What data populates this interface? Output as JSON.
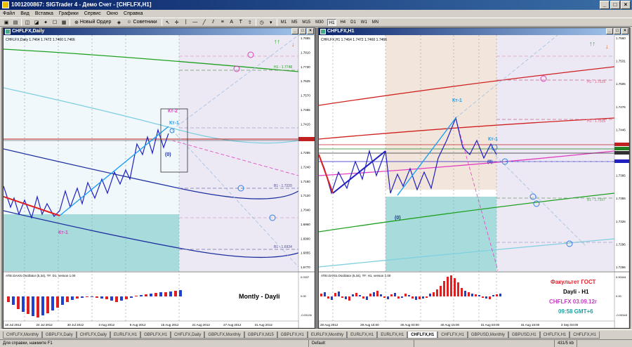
{
  "window": {
    "title": "1001200867: SIGTrader 4 - Демо Счет - [CHFLFX,H1]"
  },
  "menu": [
    "Файл",
    "Вид",
    "Вставка",
    "Графики",
    "Сервис",
    "Окно",
    "Справка"
  ],
  "toolbar": {
    "new_order": "Новый Ордер",
    "advisors": "Советники",
    "timeframes": [
      "M1",
      "M5",
      "M15",
      "M30",
      "H1",
      "H4",
      "D1",
      "W1",
      "MN"
    ],
    "active_tf": "H1"
  },
  "charts": [
    {
      "title": "CHFLFX,Daily",
      "header": "CHFLFX,Daily 1.7464 1.7472 1.7460 1.7466",
      "price_labels": [
        "1.7865",
        "1.7810",
        "1.7730",
        "1.7625",
        "1.7570",
        "1.7465",
        "1.7415",
        "1.7365",
        "1.7285",
        "1.7240",
        "1.7160",
        "1.7120",
        "1.7040",
        "1.6960",
        "1.6900",
        "1.6855",
        "1.6770"
      ],
      "date_labels": [
        "18 Jul 2012",
        "24 Jul 2012",
        "30 Jul 2012",
        "3 Aug 2012",
        "9 Aug 2012",
        "15 Aug 2012",
        "21 Aug 2012",
        "27 Aug 2012",
        "31 Aug 2012"
      ],
      "wave_labels": [
        "Кт-2",
        "Кт-1",
        "(0)",
        "Кт-1"
      ],
      "level_labels": [
        "H1 - 1.7748",
        "B1 - 1.7220",
        "B1 - 1.6934"
      ],
      "osc_header": "ATEI.DAXS.Oscillator (5,34), TF: D1, version 1.00",
      "osc_scale": [
        "0.0337",
        "0.00",
        "-0.03126"
      ],
      "note": "Montly - Dayli"
    },
    {
      "title": "CHFLFX,H1",
      "header": "CHFLFX,H1 1.7464 1.7472 1.7460 1.7466",
      "price_labels": [
        "1.7560",
        "1.7531",
        "1.7505",
        "1.7476",
        "1.7446",
        "1.7415",
        "1.7385",
        "1.7355",
        "1.7326",
        "1.7296",
        "1.7266"
      ],
      "date_labels": [
        "28 Aug 2012",
        "29 Aug 15:00",
        "30 Aug 03:00",
        "30 Aug 15:00",
        "31 Aug 03:00",
        "31 Aug 15:00",
        "3 Sep 03:00"
      ],
      "wave_labels": [
        "Кт-1",
        "Кт-1",
        "(0)",
        "(0)"
      ],
      "level_labels": [
        "H1 - 1.7529",
        "H1 - 1.7505",
        "B1 - 1.7397"
      ],
      "osc_header": "ATEI.DAXS.Oscillator (5,34), TF: H1, version 1.00",
      "osc_scale": [
        "0.00344",
        "0.00",
        "-0.00348"
      ],
      "info": {
        "line1": "Факультет ГОСТ",
        "line2": "Dayli - H1",
        "line3": "CHFLFX 03.09.12г",
        "line4": "09:58 GMT+6"
      }
    }
  ],
  "tabs": [
    "CHFLFX,Monthly",
    "GBPLFX,Daily",
    "CHFLFX,Daily",
    "EURLFX,H1",
    "GBPLFX,H1",
    "CHFLFX,Daily",
    "GBPLFX,Monthly",
    "GBPLFX,M15",
    "GBPLFX,H1",
    "EURLFX,Monthly",
    "EURLFX,H1",
    "EURLFX,H1",
    "CHFLFX,H1",
    "CHFLFX,H1",
    "GBPUSD,Monthly",
    "GBPUSD,H1",
    "CHFLFX,H1",
    "CHFLFX,H1"
  ],
  "active_tab": "CHFLFX,H1",
  "status": {
    "help": "Для справки, нажмите F1",
    "profile": "Default",
    "traffic": "431/5 kb"
  },
  "colors": {
    "wave": "#2020c0",
    "up": "#1e90ff",
    "down": "#e02020",
    "magenta": "#e040c0",
    "green": "#20a020",
    "cyan": "#80d0e0"
  }
}
